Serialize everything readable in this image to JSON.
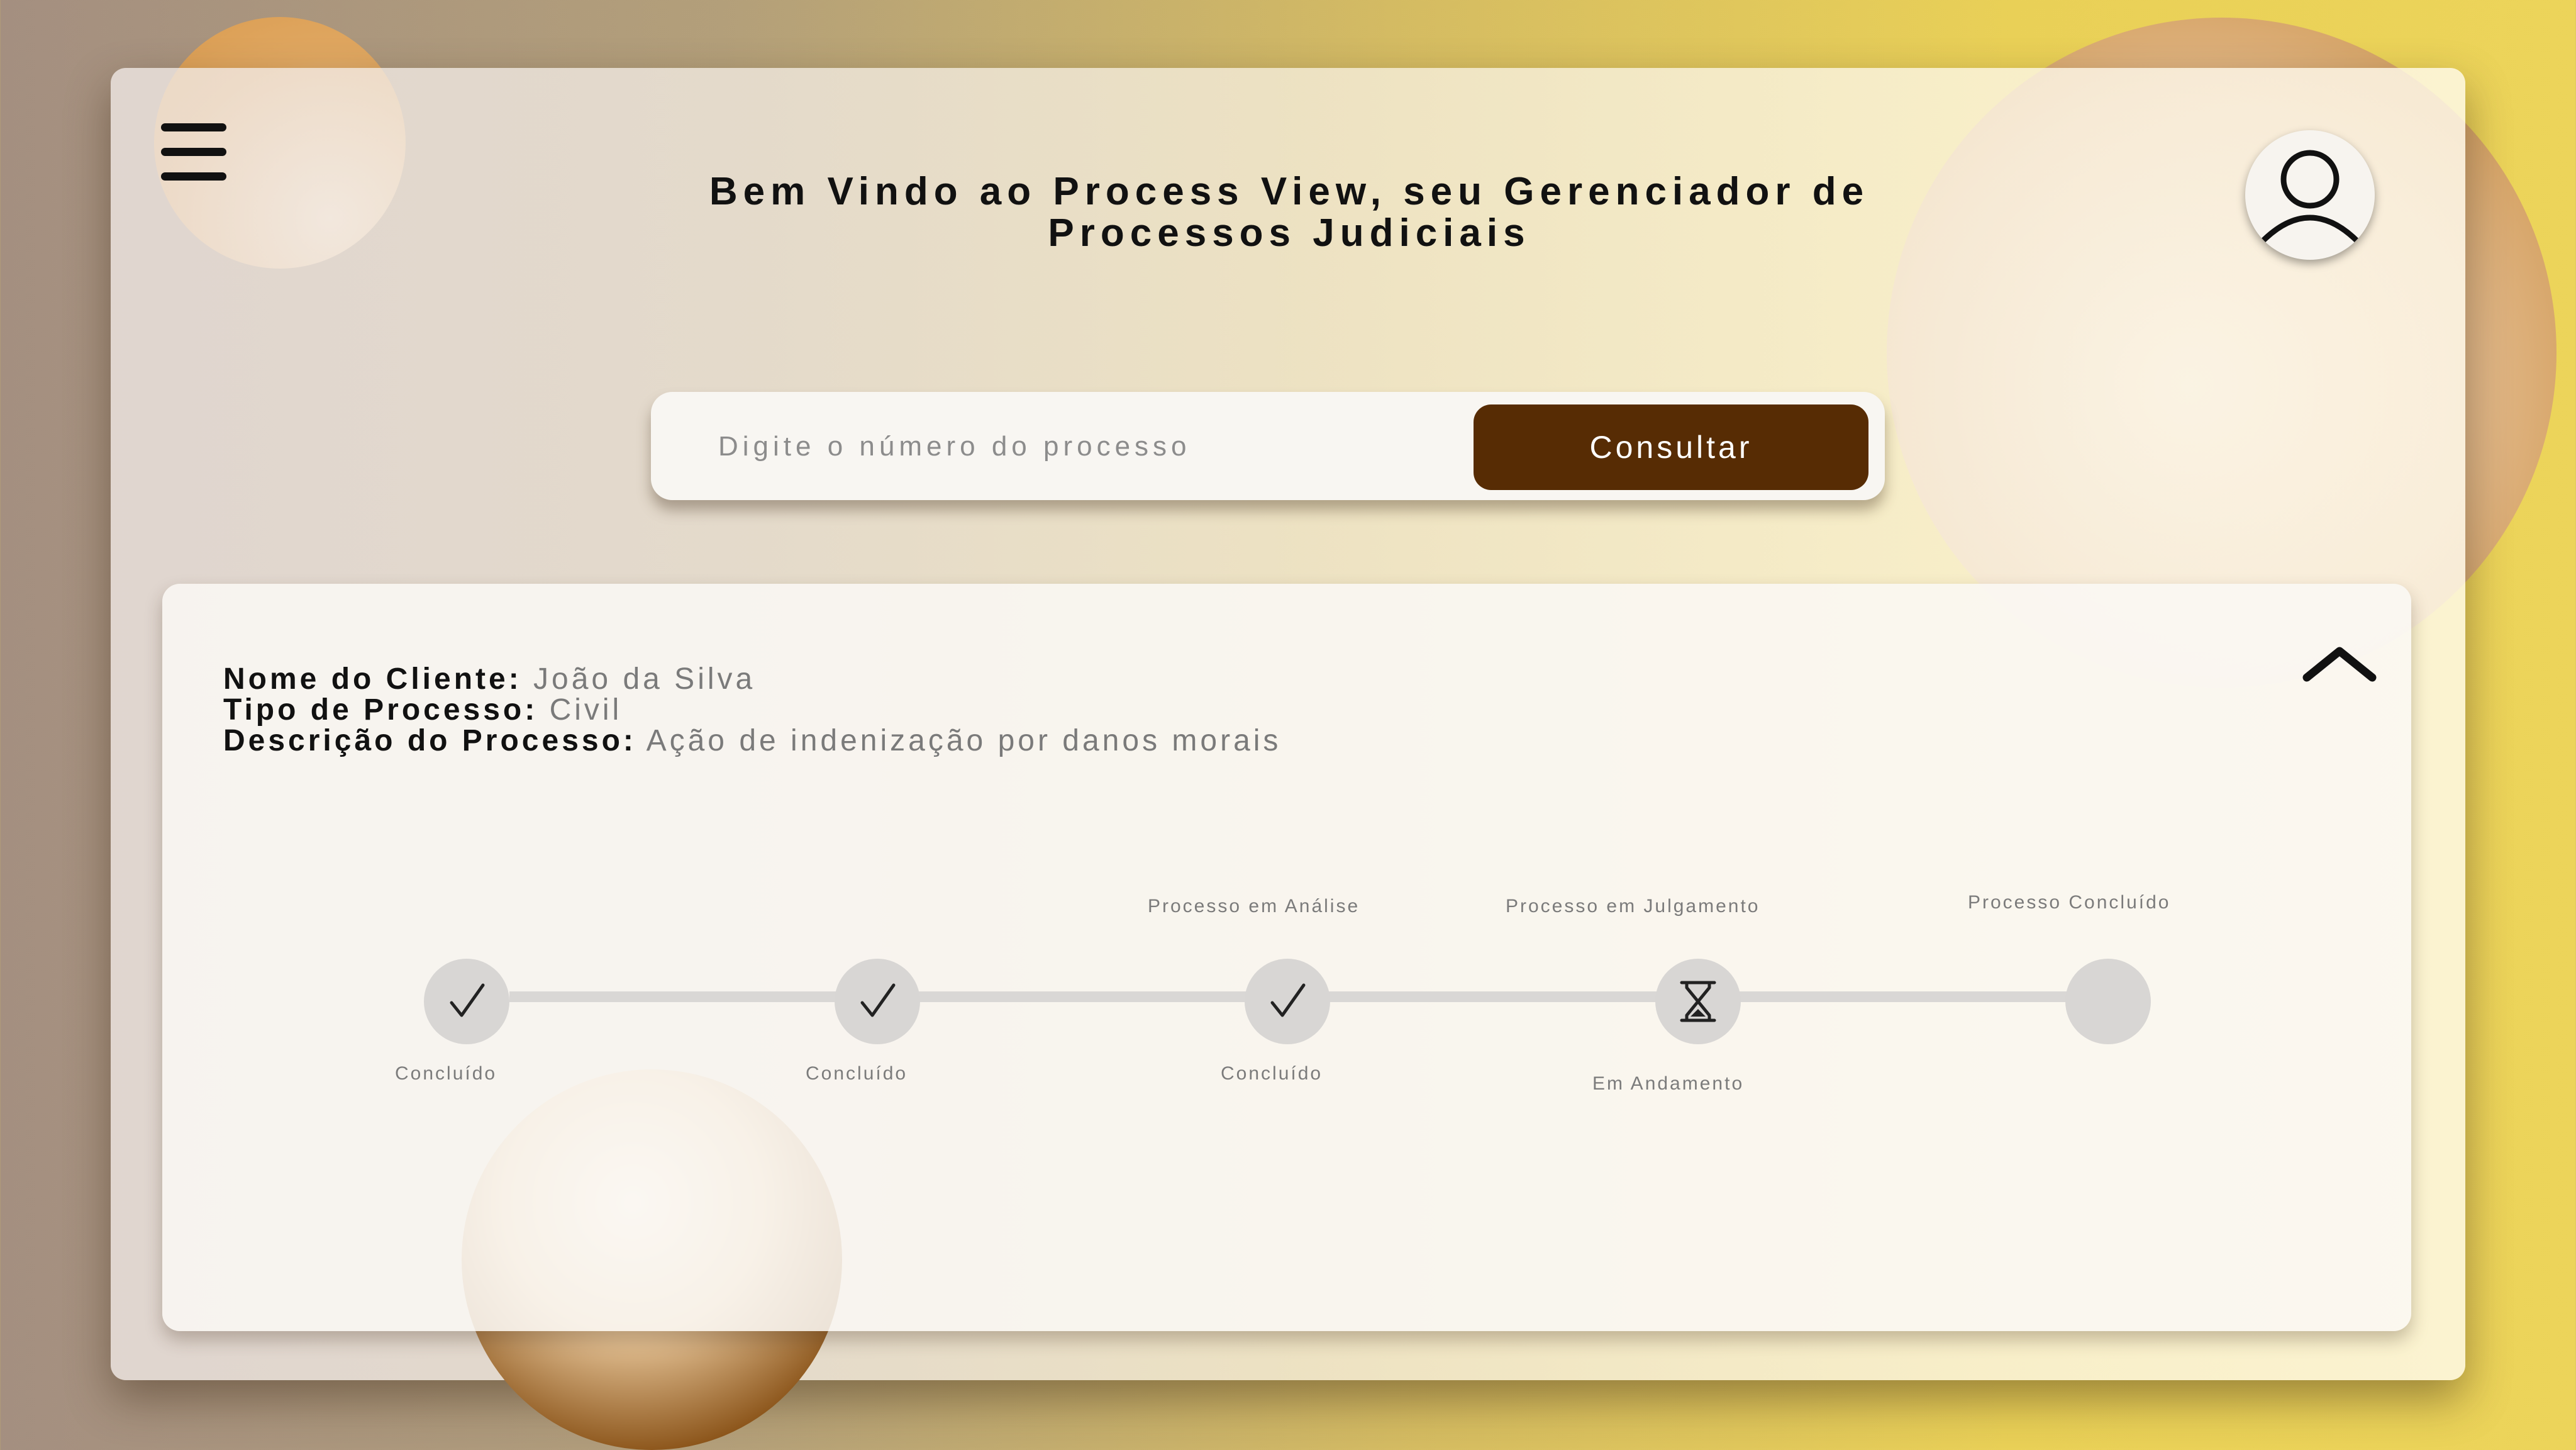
{
  "header": {
    "title_line1": "Bem Vindo ao Process View, seu Gerenciador de",
    "title_line2": "Processos Judiciais",
    "menu_icon": "hamburger-menu-icon",
    "profile_icon": "user-profile-icon"
  },
  "search": {
    "placeholder": "Digite o número do processo",
    "button_label": "Consultar",
    "button_color": "#572c04"
  },
  "process": {
    "client_label": "Nome do Cliente:",
    "client_value": "João da Silva",
    "type_label": "Tipo de Processo:",
    "type_value": "Civil",
    "description_label": "Descrição do Processo:",
    "description_value": "Ação de indenização por danos morais",
    "collapse_icon": "chevron-up-icon"
  },
  "timeline": {
    "steps": [
      {
        "top_label": "",
        "bottom_label": "Concluído",
        "icon": "check-icon"
      },
      {
        "top_label": "",
        "bottom_label": "Concluído",
        "icon": "check-icon"
      },
      {
        "top_label": "Processo em Análise",
        "bottom_label": "Concluído",
        "icon": "check-icon"
      },
      {
        "top_label": "Processo em Julgamento",
        "bottom_label": "Em Andamento",
        "icon": "hourglass-icon"
      },
      {
        "top_label": "Processo Concluído",
        "bottom_label": "",
        "icon": ""
      }
    ]
  }
}
